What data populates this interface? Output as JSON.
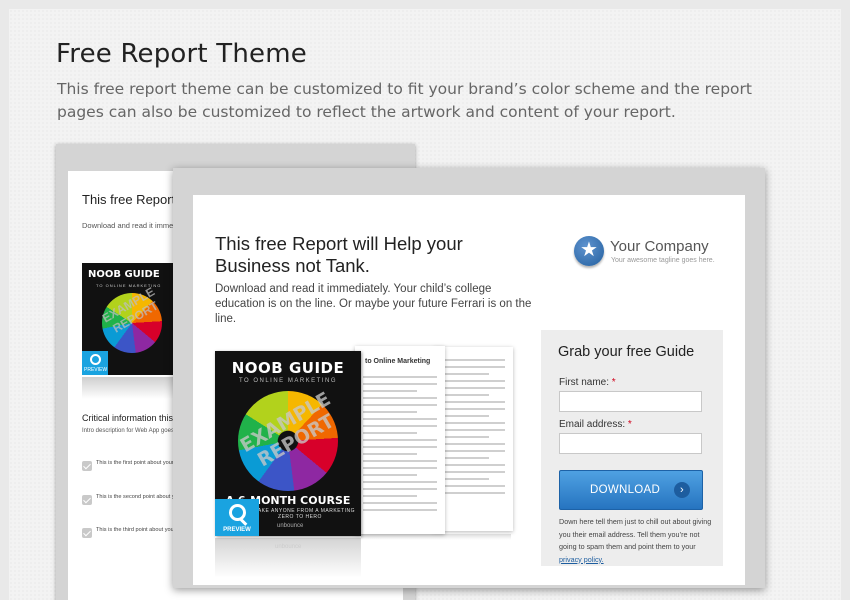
{
  "page": {
    "title": "Free Report Theme",
    "description": "This free report theme can be customized to fit your brand’s color scheme and the report pages can also be customized to reflect the artwork and content of your report."
  },
  "landing": {
    "headline": "This free Report will Help your Business not Tank.",
    "subheadline": "Download and read it immediately. Your child’s college education is on the line. Or maybe your future Ferrari is on the line.",
    "logo": {
      "name": "Your Company",
      "tagline": "Your awesome tagline goes here.",
      "icon": "star-icon"
    },
    "form": {
      "title": "Grab your free Guide",
      "first_name_label": "First name:",
      "email_label": "Email address:",
      "required_mark": "*",
      "first_name_value": "",
      "email_value": "",
      "button_label": "DOWNLOAD",
      "button_icon": "arrow-right-icon",
      "note_prefix": "Down here tell them just to chill out about giving you their email address. Tell them you’re not going to spam them and point them to your ",
      "privacy_link": "privacy policy.",
      "accent": "#2f86d1"
    },
    "book": {
      "title": "NOOB GUIDE",
      "subtitle": "TO ONLINE MARKETING",
      "stamp_line1": "EXAMPLE",
      "stamp_line2": "REPORT",
      "course": "A 6-MONTH COURSE",
      "course_sub": "TO TAKE ANYONE FROM A MARKETING ZERO TO HERO",
      "brand": "unbounce",
      "preview_label": "PREVIEW",
      "preview_icon": "magnifier-icon",
      "preview_color": "#1aa3e0"
    },
    "doc_page_title": "to Online Marketing"
  },
  "back_page": {
    "headline": "This free Report w Business not Tank",
    "subheadline": "Download and read it immediate is on the line. Or maybe your fu",
    "book_title": "NOOB GUIDE",
    "book_subtitle": "TO ONLINE MARKETING",
    "stamp": "EXAMPLE REPORT",
    "preview_label": "PREVIEW",
    "critical_title": "Critical information this R",
    "critical_sub": "Intro description for Web App goes here. Bl to change their Business. For the better of buy a Web App like that.",
    "points": [
      "This is the first point about your rep download. If it doesn't, be more pu they have that brought them to this",
      "This is the second point about your download. If it doesn't, be more pu they have that brought them to this",
      "This is the third point about your re download. If it doesn't, be more pu they have that brought them to this"
    ]
  }
}
